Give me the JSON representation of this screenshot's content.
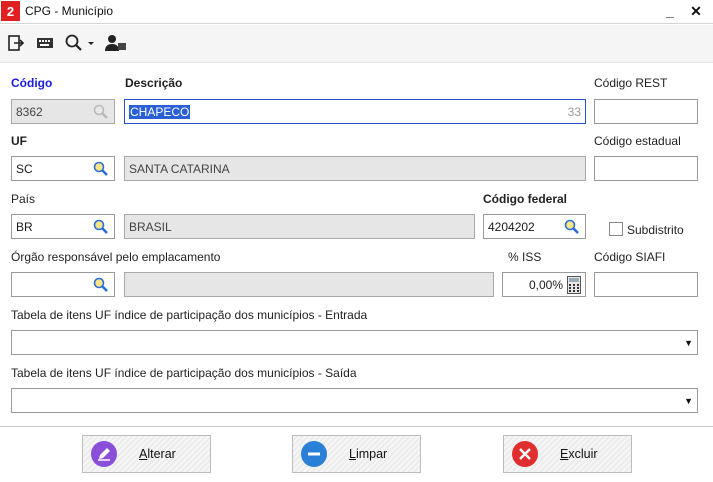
{
  "window": {
    "title": "CPG - Município",
    "app_icon_letter": "2",
    "minimize_glyph": "_",
    "close_glyph": "✕"
  },
  "toolbar": {
    "icons": [
      "exit-icon",
      "keyboard-card-icon",
      "search-dropdown-icon",
      "user-icon"
    ]
  },
  "labels": {
    "codigo": "Código",
    "descricao": "Descrição",
    "codigo_rest": "Código REST",
    "uf": "UF",
    "codigo_estadual": "Código estadual",
    "pais": "País",
    "codigo_federal": "Código federal",
    "subdistrito": "Subdistrito",
    "orgao": "Órgão responsável pelo emplacamento",
    "iss": "% ISS",
    "codigo_siafi": "Código SIAFI",
    "tabela_entrada": "Tabela de itens UF índice de participação dos municípios - Entrada",
    "tabela_saida": "Tabela de itens UF índice de participação dos municípios - Saída"
  },
  "fields": {
    "codigo": "8362",
    "descricao": "CHAPECO",
    "descricao_counter": "33",
    "codigo_rest": "",
    "uf": "SC",
    "uf_nome": "SANTA CATARINA",
    "codigo_estadual": "",
    "pais": "BR",
    "pais_nome": "BRASIL",
    "codigo_federal": "4204202",
    "subdistrito_checked": false,
    "orgao": "",
    "orgao_nome": "",
    "iss": "0,00%",
    "codigo_siafi": "",
    "tabela_entrada": "",
    "tabela_saida": ""
  },
  "buttons": {
    "alterar_prefix": "",
    "alterar_key": "A",
    "alterar_rest": "lterar",
    "limpar_key": "L",
    "limpar_rest": "impar",
    "excluir_key": "E",
    "excluir_rest": "xcluir"
  },
  "colors": {
    "accent_blue": "#1a1ae0",
    "selection": "#2a5fd6",
    "alterar_icon": "#8a4fd8",
    "limpar_icon": "#2a7fd6",
    "excluir_icon": "#e02e2e",
    "app_icon": "#e02020"
  }
}
